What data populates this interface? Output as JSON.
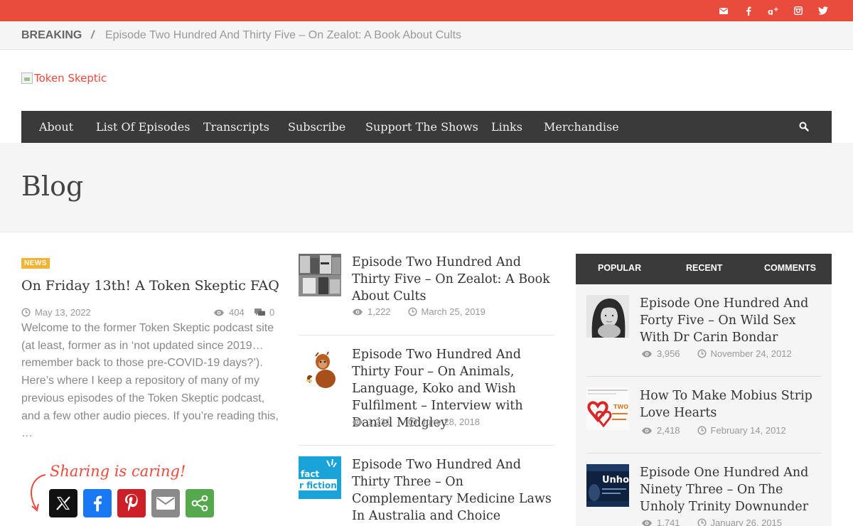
{
  "top_bar": {
    "accent": "#e94b3c",
    "social_icons": [
      "mail-icon",
      "facebook-icon",
      "google-plus-icon",
      "instagram-icon",
      "twitter-icon"
    ]
  },
  "breaking": {
    "label": "BREAKING",
    "separator": "/",
    "headline": "Episode Two Hundred And Thirty Five – On Zealot: A Book About Cults"
  },
  "logo": {
    "alt_text": "Token Skeptic"
  },
  "nav": {
    "items": [
      "About",
      "List Of Episodes",
      "Transcripts",
      "Subscribe",
      "Support The Shows",
      "Links",
      "Merchandise"
    ],
    "search_icon": "search-icon"
  },
  "page": {
    "title": "Blog"
  },
  "lead_post": {
    "category": "NEWS",
    "title": "On Friday 13th! A Token Skeptic FAQ",
    "date": "May 13, 2022",
    "views": "404",
    "comments": "0",
    "excerpt": "Welcome to the former Token Skeptic podcast site (at least, former as in ‘not updated since 2019… remember back to those pre-COVID-19 days?’). Here’s where I keep a repository of many of my previous episodes of the Token Skeptic podcast, and a few other audio pieces. If you’re reading this, …"
  },
  "sharing": {
    "caption": "Sharing is caring!",
    "buttons": [
      "x-share-button",
      "facebook-share-button",
      "pinterest-share-button",
      "email-share-button",
      "more-share-button"
    ]
  },
  "posts": [
    {
      "title": "Episode Two Hundred And Thirty Five – On Zealot: A Book About Cults",
      "views": "1,222",
      "date": "March 25, 2019"
    },
    {
      "title": "Episode Two Hundred And Thirty Four – On Animals, Language, Koko and Wish Fulfilment – Interview with Daniel Midgley",
      "views": "1,231",
      "date": "June 28, 2018"
    },
    {
      "title": "Episode Two Hundred And Thirty Three – On Complementary Medicine Laws In Australia and Choice Campaign",
      "thumb_text_1": "fact",
      "thumb_text_2": "r fiction"
    }
  ],
  "sidebar": {
    "tabs": [
      "POPULAR",
      "RECENT",
      "COMMENTS"
    ],
    "items": [
      {
        "title": "Episode One Hundred And Forty Five – On Wild Sex With Dr Carin Bondar",
        "views": "3,956",
        "date": "November 24, 2012"
      },
      {
        "title": "How To Make Mobius Strip Love Hearts",
        "views": "2,418",
        "date": "February 14, 2012",
        "thumb_text": "TWO"
      },
      {
        "title": "Episode One Hundred And Ninety Three – On The Unholy Trinity Downunder",
        "views": "1,741",
        "date": "January 26, 2015",
        "thumb_text": "Unho"
      }
    ]
  }
}
